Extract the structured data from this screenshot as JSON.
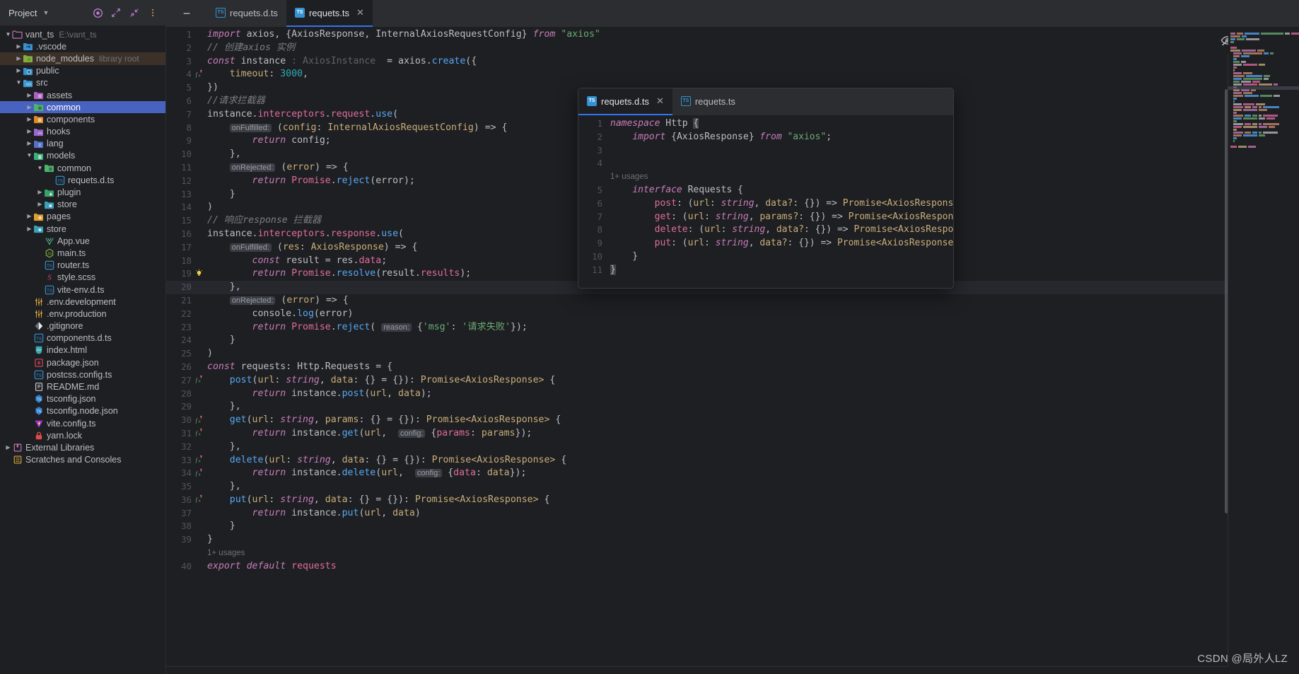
{
  "sidebar": {
    "title": "Project",
    "header_icons": [
      "target-icon",
      "expand-icon",
      "collapse-icon",
      "more-options-icon"
    ],
    "tree": [
      {
        "depth": 0,
        "arrow": "open",
        "icon": "folder-project",
        "label": "vant_ts",
        "sub": "E:\\vant_ts",
        "selected": false,
        "highlight": false
      },
      {
        "depth": 1,
        "arrow": "closed",
        "icon": "folder-vscode",
        "label": ".vscode",
        "sub": "",
        "selected": false,
        "highlight": false
      },
      {
        "depth": 1,
        "arrow": "closed",
        "icon": "folder-node",
        "label": "node_modules",
        "sub": "library root",
        "selected": false,
        "highlight": true
      },
      {
        "depth": 1,
        "arrow": "closed",
        "icon": "folder-public",
        "label": "public",
        "sub": "",
        "selected": false,
        "highlight": false
      },
      {
        "depth": 1,
        "arrow": "open",
        "icon": "folder-src",
        "label": "src",
        "sub": "",
        "selected": false,
        "highlight": false
      },
      {
        "depth": 2,
        "arrow": "closed",
        "icon": "folder-assets",
        "label": "assets",
        "sub": "",
        "selected": false,
        "highlight": false
      },
      {
        "depth": 2,
        "arrow": "closed",
        "icon": "folder-common",
        "label": "common",
        "sub": "",
        "selected": true,
        "highlight": false
      },
      {
        "depth": 2,
        "arrow": "closed",
        "icon": "folder-components",
        "label": "components",
        "sub": "",
        "selected": false,
        "highlight": false
      },
      {
        "depth": 2,
        "arrow": "closed",
        "icon": "folder-hooks",
        "label": "hooks",
        "sub": "",
        "selected": false,
        "highlight": false
      },
      {
        "depth": 2,
        "arrow": "closed",
        "icon": "folder-lang",
        "label": "lang",
        "sub": "",
        "selected": false,
        "highlight": false
      },
      {
        "depth": 2,
        "arrow": "open",
        "icon": "folder-models",
        "label": "models",
        "sub": "",
        "selected": false,
        "highlight": false
      },
      {
        "depth": 3,
        "arrow": "open",
        "icon": "folder-common",
        "label": "common",
        "sub": "",
        "selected": false,
        "highlight": false
      },
      {
        "depth": 4,
        "arrow": "none",
        "icon": "ts-file",
        "label": "requets.d.ts",
        "sub": "",
        "selected": false,
        "highlight": false
      },
      {
        "depth": 3,
        "arrow": "closed",
        "icon": "folder-plugin",
        "label": "plugin",
        "sub": "",
        "selected": false,
        "highlight": false
      },
      {
        "depth": 3,
        "arrow": "closed",
        "icon": "folder-store",
        "label": "store",
        "sub": "",
        "selected": false,
        "highlight": false
      },
      {
        "depth": 2,
        "arrow": "closed",
        "icon": "folder-pages",
        "label": "pages",
        "sub": "",
        "selected": false,
        "highlight": false
      },
      {
        "depth": 2,
        "arrow": "closed",
        "icon": "folder-store",
        "label": "store",
        "sub": "",
        "selected": false,
        "highlight": false
      },
      {
        "depth": 3,
        "arrow": "none",
        "icon": "vue-file",
        "label": "App.vue",
        "sub": "",
        "selected": false,
        "highlight": false
      },
      {
        "depth": 3,
        "arrow": "none",
        "icon": "js-file",
        "label": "main.ts",
        "sub": "",
        "selected": false,
        "highlight": false
      },
      {
        "depth": 3,
        "arrow": "none",
        "icon": "ts-file",
        "label": "router.ts",
        "sub": "",
        "selected": false,
        "highlight": false
      },
      {
        "depth": 3,
        "arrow": "none",
        "icon": "scss-file",
        "label": "style.scss",
        "sub": "",
        "selected": false,
        "highlight": false
      },
      {
        "depth": 3,
        "arrow": "none",
        "icon": "ts-file",
        "label": "vite-env.d.ts",
        "sub": "",
        "selected": false,
        "highlight": false
      },
      {
        "depth": 2,
        "arrow": "none",
        "icon": "env-file",
        "label": ".env.development",
        "sub": "",
        "selected": false,
        "highlight": false
      },
      {
        "depth": 2,
        "arrow": "none",
        "icon": "env-file",
        "label": ".env.production",
        "sub": "",
        "selected": false,
        "highlight": false
      },
      {
        "depth": 2,
        "arrow": "none",
        "icon": "git-file",
        "label": ".gitignore",
        "sub": "",
        "selected": false,
        "highlight": false
      },
      {
        "depth": 2,
        "arrow": "none",
        "icon": "ts-file",
        "label": "components.d.ts",
        "sub": "",
        "selected": false,
        "highlight": false
      },
      {
        "depth": 2,
        "arrow": "none",
        "icon": "html-file",
        "label": "index.html",
        "sub": "",
        "selected": false,
        "highlight": false
      },
      {
        "depth": 2,
        "arrow": "none",
        "icon": "json-file",
        "label": "package.json",
        "sub": "",
        "selected": false,
        "highlight": false
      },
      {
        "depth": 2,
        "arrow": "none",
        "icon": "ts-file",
        "label": "postcss.config.ts",
        "sub": "",
        "selected": false,
        "highlight": false
      },
      {
        "depth": 2,
        "arrow": "none",
        "icon": "md-file",
        "label": "README.md",
        "sub": "",
        "selected": false,
        "highlight": false
      },
      {
        "depth": 2,
        "arrow": "none",
        "icon": "tsconfig-file",
        "label": "tsconfig.json",
        "sub": "",
        "selected": false,
        "highlight": false
      },
      {
        "depth": 2,
        "arrow": "none",
        "icon": "tsconfig-file",
        "label": "tsconfig.node.json",
        "sub": "",
        "selected": false,
        "highlight": false
      },
      {
        "depth": 2,
        "arrow": "none",
        "icon": "vite-file",
        "label": "vite.config.ts",
        "sub": "",
        "selected": false,
        "highlight": false
      },
      {
        "depth": 2,
        "arrow": "none",
        "icon": "lock-file",
        "label": "yarn.lock",
        "sub": "",
        "selected": false,
        "highlight": false
      },
      {
        "depth": 0,
        "arrow": "closed",
        "icon": "libraries",
        "label": "External Libraries",
        "sub": "",
        "selected": false,
        "highlight": false
      },
      {
        "depth": 0,
        "arrow": "none",
        "icon": "scratches",
        "label": "Scratches and Consoles",
        "sub": "",
        "selected": false,
        "highlight": false
      }
    ]
  },
  "editor": {
    "tabs": [
      {
        "label": "requets.d.ts",
        "active": false,
        "closable": false
      },
      {
        "label": "requets.ts",
        "active": true,
        "closable": true
      }
    ],
    "filename": "requets.ts",
    "status_icons": [
      "hide-inspections-icon",
      "no-problems-check-icon"
    ],
    "lines": [
      {
        "n": "1",
        "gutter": "",
        "html": "<span class=\"kwi\">import</span> <span class=\"id\">axios</span>, {<span class=\"id\">AxiosResponse</span>, <span class=\"id\">InternalAxiosRequestConfig</span>} <span class=\"kwi\">from</span> <span class=\"str\">\"axios\"</span>"
      },
      {
        "n": "2",
        "gutter": "",
        "html": "<span class=\"cmt\">// 创建axios 实例</span>"
      },
      {
        "n": "3",
        "gutter": "",
        "html": "<span class=\"kwi\">const</span> <span class=\"id\">instance</span> <span class=\"ghost\">: AxiosInstance</span>  = <span class=\"id\">axios</span>.<span class=\"fn\">create</span>({"
      },
      {
        "n": "4",
        "gutter": "fx",
        "html": "    <span class=\"orange\">timeout</span>: <span class=\"num\">3000</span>,"
      },
      {
        "n": "5",
        "gutter": "",
        "html": "})"
      },
      {
        "n": "6",
        "gutter": "",
        "html": "<span class=\"cmt\">//请求拦截器</span>"
      },
      {
        "n": "7",
        "gutter": "",
        "html": "<span class=\"id\">instance</span>.<span class=\"pink\">interceptors</span>.<span class=\"pink\">request</span>.<span class=\"fn\">use</span>("
      },
      {
        "n": "8",
        "gutter": "",
        "html": "    <span class=\"inlay\">onFulfilled:</span> (<span class=\"orange\">config</span>: <span class=\"orange\">InternalAxiosRequestConfig</span>) =&gt; {"
      },
      {
        "n": "9",
        "gutter": "",
        "html": "        <span class=\"kwi\">return</span> <span class=\"id\">config</span>;"
      },
      {
        "n": "10",
        "gutter": "",
        "html": "    },"
      },
      {
        "n": "11",
        "gutter": "",
        "html": "    <span class=\"inlay\">onRejected:</span> (<span class=\"orange\">error</span>) =&gt; {"
      },
      {
        "n": "12",
        "gutter": "",
        "html": "        <span class=\"kwi\">return</span> <span class=\"pink\">Promise</span>.<span class=\"fn\">reject</span>(<span class=\"id\">error</span>);"
      },
      {
        "n": "13",
        "gutter": "",
        "html": "    }"
      },
      {
        "n": "14",
        "gutter": "",
        "html": ")"
      },
      {
        "n": "15",
        "gutter": "",
        "html": "<span class=\"cmt\">// 响应response 拦截器</span>"
      },
      {
        "n": "16",
        "gutter": "",
        "html": "<span class=\"id\">instance</span>.<span class=\"pink\">interceptors</span>.<span class=\"pink\">response</span>.<span class=\"fn\">use</span>("
      },
      {
        "n": "17",
        "gutter": "",
        "html": "    <span class=\"inlay\">onFulfilled:</span> (<span class=\"orange\">res</span>: <span class=\"orange\">AxiosResponse</span>) =&gt; {"
      },
      {
        "n": "18",
        "gutter": "",
        "html": "        <span class=\"kwi\">const</span> <span class=\"id\">result</span> = <span class=\"id\">res</span>.<span class=\"pink\">data</span>;"
      },
      {
        "n": "19",
        "gutter": "bulb",
        "html": "        <span class=\"kwi\">return</span> <span class=\"pink\">Promise</span>.<span class=\"fn\">resolve</span>(<span class=\"id\">result</span>.<span class=\"pink\">results</span>);"
      },
      {
        "n": "20",
        "gutter": "",
        "html": "    },",
        "current": true
      },
      {
        "n": "21",
        "gutter": "",
        "html": "    <span class=\"inlay\">onRejected:</span> (<span class=\"orange\">error</span>) =&gt; {"
      },
      {
        "n": "22",
        "gutter": "",
        "html": "        <span class=\"id\">console</span>.<span class=\"fn\">log</span>(<span class=\"id\">error</span>)"
      },
      {
        "n": "23",
        "gutter": "",
        "html": "        <span class=\"kwi\">return</span> <span class=\"pink\">Promise</span>.<span class=\"fn\">reject</span>( <span class=\"inlay\">reason:</span> {<span class=\"str\">'msg'</span>: <span class=\"str\">'请求失败'</span>});"
      },
      {
        "n": "24",
        "gutter": "",
        "html": "    }"
      },
      {
        "n": "25",
        "gutter": "",
        "html": ")"
      },
      {
        "n": "26",
        "gutter": "",
        "html": "<span class=\"kwi\">const</span> <span class=\"id\">requests</span>: <span class=\"id\">Http</span>.<span class=\"id\">Requests</span> = {"
      },
      {
        "n": "27",
        "gutter": "fx",
        "html": "    <span class=\"fn\">post</span>(<span class=\"orange\">url</span>: <span class=\"kwi\" style=\"font-style:italic\">string</span>, <span class=\"orange\">data</span>: {} = {}): <span class=\"orange\">Promise&lt;AxiosResponse&gt;</span> {"
      },
      {
        "n": "28",
        "gutter": "",
        "html": "        <span class=\"kwi\">return</span> <span class=\"id\">instance</span>.<span class=\"fn\">post</span>(<span class=\"orange\">url</span>, <span class=\"orange\">data</span>);"
      },
      {
        "n": "29",
        "gutter": "",
        "html": "    },"
      },
      {
        "n": "30",
        "gutter": "fx",
        "html": "    <span class=\"fn\">get</span>(<span class=\"orange\">url</span>: <span class=\"kwi\" style=\"font-style:italic\">string</span>, <span class=\"orange\">params</span>: {} = {}): <span class=\"orange\">Promise&lt;AxiosResponse&gt;</span> {"
      },
      {
        "n": "31",
        "gutter": "fx",
        "html": "        <span class=\"kwi\">return</span> <span class=\"id\">instance</span>.<span class=\"fn\">get</span>(<span class=\"orange\">url</span>,  <span class=\"inlay\">config:</span> {<span class=\"pink\">params</span>: <span class=\"orange\">params</span>});"
      },
      {
        "n": "32",
        "gutter": "",
        "html": "    },"
      },
      {
        "n": "33",
        "gutter": "fx",
        "html": "    <span class=\"fn\">delete</span>(<span class=\"orange\">url</span>: <span class=\"kwi\" style=\"font-style:italic\">string</span>, <span class=\"orange\">data</span>: {} = {}): <span class=\"orange\">Promise&lt;AxiosResponse&gt;</span> {"
      },
      {
        "n": "34",
        "gutter": "fx",
        "html": "        <span class=\"kwi\">return</span> <span class=\"id\">instance</span>.<span class=\"fn\">delete</span>(<span class=\"orange\">url</span>,  <span class=\"inlay\">config:</span> {<span class=\"pink\">data</span>: <span class=\"orange\">data</span>});"
      },
      {
        "n": "35",
        "gutter": "",
        "html": "    },"
      },
      {
        "n": "36",
        "gutter": "fx",
        "html": "    <span class=\"fn\">put</span>(<span class=\"orange\">url</span>: <span class=\"kwi\" style=\"font-style:italic\">string</span>, <span class=\"orange\">data</span>: {} = {}): <span class=\"orange\">Promise&lt;AxiosResponse&gt;</span> {"
      },
      {
        "n": "37",
        "gutter": "",
        "html": "        <span class=\"kwi\">return</span> <span class=\"id\">instance</span>.<span class=\"fn\">put</span>(<span class=\"orange\">url</span>, <span class=\"orange\">data</span>)"
      },
      {
        "n": "38",
        "gutter": "",
        "html": "    }"
      },
      {
        "n": "39",
        "gutter": "",
        "html": "}"
      },
      {
        "n": "",
        "gutter": "",
        "usages": "1+ usages"
      },
      {
        "n": "40",
        "gutter": "",
        "html": "<span class=\"kwi\">export</span> <span class=\"kwi\">default</span> <span class=\"pink\">requests</span>"
      }
    ]
  },
  "popup": {
    "tabs": [
      {
        "label": "requets.d.ts",
        "active": true,
        "closable": true
      },
      {
        "label": "requets.ts",
        "active": false,
        "closable": false
      }
    ],
    "lines": [
      {
        "n": "1",
        "html": "<span class=\"kwi\">namespace</span> <span class=\"id\">Http</span> <span class=\"selbg\">{</span>"
      },
      {
        "n": "2",
        "html": "    <span class=\"kwi\">import</span> {<span class=\"id\">AxiosResponse</span>} <span class=\"kwi\">from</span> <span class=\"str\">\"axios\"</span>;"
      },
      {
        "n": "3",
        "html": ""
      },
      {
        "n": "4",
        "html": ""
      },
      {
        "n": "",
        "usages": "1+ usages"
      },
      {
        "n": "5",
        "html": "    <span class=\"kwi\">interface</span> <span class=\"id\">Requests</span> {"
      },
      {
        "n": "6",
        "html": "        <span class=\"pink\">post</span>: (<span class=\"orange\">url</span>: <span class=\"kwi\" style=\"font-style:italic\">string</span>, <span class=\"orange\">data?</span>: {}) =&gt; <span class=\"orange\">Promise&lt;AxiosResponse&gt;</span>;"
      },
      {
        "n": "7",
        "html": "        <span class=\"pink\">get</span>: (<span class=\"orange\">url</span>: <span class=\"kwi\" style=\"font-style:italic\">string</span>, <span class=\"orange\">params?</span>: {}) =&gt; <span class=\"orange\">Promise&lt;AxiosResponse&gt;</span>;"
      },
      {
        "n": "8",
        "html": "        <span class=\"pink\">delete</span>: (<span class=\"orange\">url</span>: <span class=\"kwi\" style=\"font-style:italic\">string</span>, <span class=\"orange\">data?</span>: {}) =&gt; <span class=\"orange\">Promise&lt;AxiosResponse&gt;</span>;"
      },
      {
        "n": "9",
        "html": "        <span class=\"pink\">put</span>: (<span class=\"orange\">url</span>: <span class=\"kwi\" style=\"font-style:italic\">string</span>, <span class=\"orange\">data?</span>: {}) =&gt; <span class=\"orange\">Promise&lt;AxiosResponse&gt;</span>;"
      },
      {
        "n": "10",
        "html": "    }"
      },
      {
        "n": "11",
        "html": "<span class=\"selbg\">}</span>"
      }
    ]
  },
  "watermark": "CSDN @局外人LZ",
  "colors": {
    "accent": "#3574f0",
    "selection": "#4863bf",
    "background": "#1e1f22",
    "panel": "#2b2d30",
    "text": "#bcbec4"
  }
}
